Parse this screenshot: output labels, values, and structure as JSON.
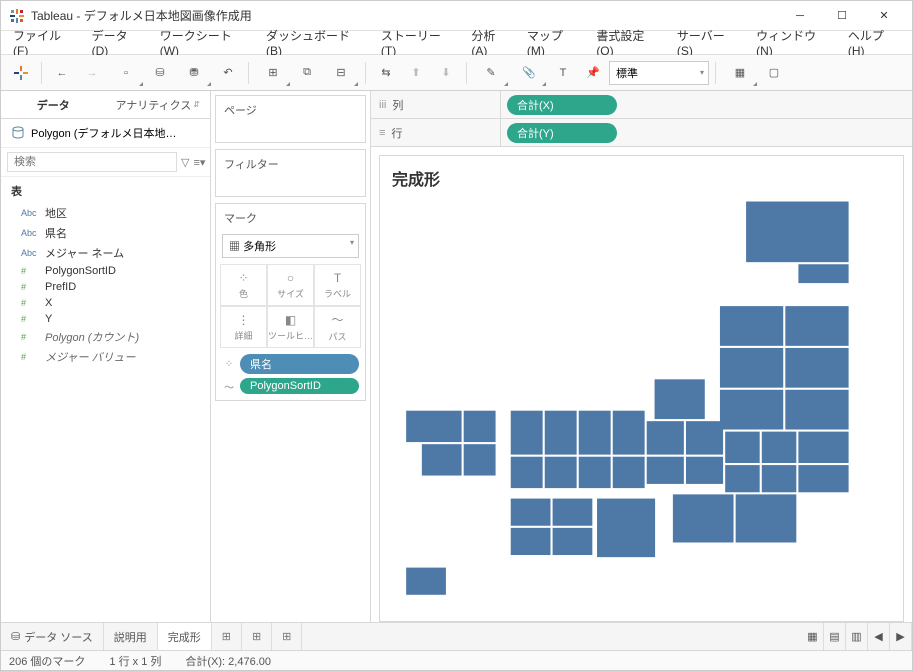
{
  "window": {
    "title": "Tableau - デフォルメ日本地図画像作成用"
  },
  "menu": [
    "ファイル(F)",
    "データ(D)",
    "ワークシート(W)",
    "ダッシュボード(B)",
    "ストーリー(T)",
    "分析(A)",
    "マップ(M)",
    "書式設定(O)",
    "サーバー(S)",
    "ウィンドウ(N)",
    "ヘルプ(H)"
  ],
  "toolbar": {
    "fit": "標準"
  },
  "left_tabs": {
    "data": "データ",
    "analytics": "アナリティクス"
  },
  "datasource": "Polygon (デフォルメ日本地…",
  "search_placeholder": "検索",
  "table_header": "表",
  "fields": {
    "dims": [
      {
        "type": "Abc",
        "name": "地区"
      },
      {
        "type": "Abc",
        "name": "県名"
      },
      {
        "type": "Abc",
        "name": "メジャー ネーム"
      }
    ],
    "meas": [
      {
        "type": "#",
        "name": "PolygonSortID"
      },
      {
        "type": "#",
        "name": "PrefID"
      },
      {
        "type": "#",
        "name": "X"
      },
      {
        "type": "#",
        "name": "Y"
      },
      {
        "type": "#",
        "name": "Polygon (カウント)",
        "italic": true
      },
      {
        "type": "#",
        "name": "メジャー バリュー",
        "italic": true
      }
    ]
  },
  "cards": {
    "pages": "ページ",
    "filters": "フィルター",
    "marks": "マーク",
    "mark_type": "多角形",
    "mark_cells": [
      {
        "ico": "⁘",
        "lbl": "色"
      },
      {
        "ico": "○",
        "lbl": "サイズ"
      },
      {
        "ico": "T",
        "lbl": "ラベル"
      },
      {
        "ico": "⋮",
        "lbl": "詳細"
      },
      {
        "ico": "◧",
        "lbl": "ツールヒ…"
      },
      {
        "ico": "〜",
        "lbl": "パス"
      }
    ],
    "mark_pills": [
      {
        "ico": "⁘",
        "label": "県名",
        "cls": "blue"
      },
      {
        "ico": "〜",
        "label": "PolygonSortID",
        "cls": "green"
      }
    ]
  },
  "shelves": {
    "cols_label": "列",
    "rows_label": "行",
    "cols_pill": "合計(X)",
    "rows_pill": "合計(Y)"
  },
  "canvas_title": "完成形",
  "bottom_tabs": {
    "datasource": "データ ソース",
    "sheet1": "説明用",
    "sheet2": "完成形"
  },
  "status": {
    "marks": "206 個のマーク",
    "dims": "1 行 x 1 列",
    "sum": "合計(X): 2,476.00"
  },
  "chart_data": {
    "type": "area",
    "note": "Polygon map of stylized Japan prefectures; x/y are tile grid coordinates approximated from shelves 合計(X)/合計(Y).",
    "color": "#4e79a7",
    "rects": [
      {
        "x": 14,
        "y": 0,
        "w": 4,
        "h": 3
      },
      {
        "x": 16,
        "y": 3,
        "w": 2,
        "h": 1
      },
      {
        "x": 13,
        "y": 5,
        "w": 2.5,
        "h": 2
      },
      {
        "x": 15.5,
        "y": 5,
        "w": 2.5,
        "h": 2
      },
      {
        "x": 13,
        "y": 7,
        "w": 2.5,
        "h": 2
      },
      {
        "x": 15.5,
        "y": 7,
        "w": 2.5,
        "h": 2
      },
      {
        "x": 10.5,
        "y": 8.5,
        "w": 2,
        "h": 2
      },
      {
        "x": 13,
        "y": 9,
        "w": 2.5,
        "h": 2
      },
      {
        "x": 15.5,
        "y": 9,
        "w": 2.5,
        "h": 2
      },
      {
        "x": 1,
        "y": 10,
        "w": 2.2,
        "h": 1.6
      },
      {
        "x": 3.2,
        "y": 10,
        "w": 1.3,
        "h": 1.6
      },
      {
        "x": 5,
        "y": 10,
        "w": 1.3,
        "h": 2.2
      },
      {
        "x": 6.3,
        "y": 10,
        "w": 1.3,
        "h": 2.2
      },
      {
        "x": 7.6,
        "y": 10,
        "w": 1.3,
        "h": 2.2
      },
      {
        "x": 8.9,
        "y": 10,
        "w": 1.3,
        "h": 2.2
      },
      {
        "x": 10.2,
        "y": 10.5,
        "w": 1.5,
        "h": 1.7
      },
      {
        "x": 11.7,
        "y": 10.5,
        "w": 1.5,
        "h": 1.7
      },
      {
        "x": 13.2,
        "y": 11,
        "w": 1.4,
        "h": 1.6
      },
      {
        "x": 14.6,
        "y": 11,
        "w": 1.4,
        "h": 1.6
      },
      {
        "x": 16,
        "y": 11,
        "w": 2,
        "h": 1.6
      },
      {
        "x": 1.6,
        "y": 11.6,
        "w": 1.6,
        "h": 1.6
      },
      {
        "x": 3.2,
        "y": 11.6,
        "w": 1.3,
        "h": 1.6
      },
      {
        "x": 5,
        "y": 12.2,
        "w": 1.3,
        "h": 1.6
      },
      {
        "x": 6.3,
        "y": 12.2,
        "w": 1.3,
        "h": 1.6
      },
      {
        "x": 7.6,
        "y": 12.2,
        "w": 1.3,
        "h": 1.6
      },
      {
        "x": 8.9,
        "y": 12.2,
        "w": 1.3,
        "h": 1.6
      },
      {
        "x": 10.2,
        "y": 12.2,
        "w": 1.5,
        "h": 1.4
      },
      {
        "x": 11.7,
        "y": 12.2,
        "w": 1.5,
        "h": 1.4
      },
      {
        "x": 13.2,
        "y": 12.6,
        "w": 1.4,
        "h": 1.4
      },
      {
        "x": 14.6,
        "y": 12.6,
        "w": 1.4,
        "h": 1.4
      },
      {
        "x": 16,
        "y": 12.6,
        "w": 2,
        "h": 1.4
      },
      {
        "x": 5,
        "y": 14.2,
        "w": 1.6,
        "h": 1.4
      },
      {
        "x": 6.6,
        "y": 14.2,
        "w": 1.6,
        "h": 1.4
      },
      {
        "x": 8.3,
        "y": 14.2,
        "w": 2.3,
        "h": 2.9
      },
      {
        "x": 11.2,
        "y": 14,
        "w": 2.4,
        "h": 2.4
      },
      {
        "x": 13.6,
        "y": 14,
        "w": 2.4,
        "h": 2.4
      },
      {
        "x": 5,
        "y": 15.6,
        "w": 1.6,
        "h": 1.4
      },
      {
        "x": 6.6,
        "y": 15.6,
        "w": 1.6,
        "h": 1.4
      },
      {
        "x": 1,
        "y": 17.5,
        "w": 1.6,
        "h": 1.4
      }
    ],
    "xlim": [
      0,
      20
    ],
    "ylim": [
      0,
      20
    ]
  }
}
